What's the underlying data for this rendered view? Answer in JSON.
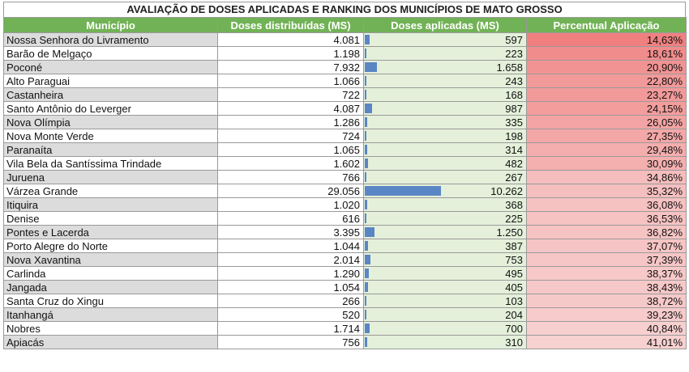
{
  "title": "AVALIAÇÃO DE DOSES APLICADAS E RANKING DOS MUNICÍPIOS DE MATO GROSSO",
  "headers": [
    "Município",
    "Doses distribuídas (MS)",
    "Doses aplicadas (MS)",
    "Percentual Aplicação"
  ],
  "colors": {
    "header_bg": "#72b256",
    "applied_bg": "#e4f0da",
    "databar": "#5b86c5",
    "pct_low": "#f08080",
    "pct_high": "#f7d0d0"
  },
  "rows": [
    {
      "municipio": "Nossa Senhora do Livramento",
      "distribuidas": "4.081",
      "aplicadas": "597",
      "percentual": "14,63%",
      "pct": 14.63,
      "aplicadas_num": 597
    },
    {
      "municipio": "Barão de Melgaço",
      "distribuidas": "1.198",
      "aplicadas": "223",
      "percentual": "18,61%",
      "pct": 18.61,
      "aplicadas_num": 223
    },
    {
      "municipio": "Poconé",
      "distribuidas": "7.932",
      "aplicadas": "1.658",
      "percentual": "20,90%",
      "pct": 20.9,
      "aplicadas_num": 1658
    },
    {
      "municipio": "Alto Paraguai",
      "distribuidas": "1.066",
      "aplicadas": "243",
      "percentual": "22,80%",
      "pct": 22.8,
      "aplicadas_num": 243
    },
    {
      "municipio": "Castanheira",
      "distribuidas": "722",
      "aplicadas": "168",
      "percentual": "23,27%",
      "pct": 23.27,
      "aplicadas_num": 168
    },
    {
      "municipio": "Santo Antônio do Leverger",
      "distribuidas": "4.087",
      "aplicadas": "987",
      "percentual": "24,15%",
      "pct": 24.15,
      "aplicadas_num": 987
    },
    {
      "municipio": "Nova Olímpia",
      "distribuidas": "1.286",
      "aplicadas": "335",
      "percentual": "26,05%",
      "pct": 26.05,
      "aplicadas_num": 335
    },
    {
      "municipio": "Nova Monte Verde",
      "distribuidas": "724",
      "aplicadas": "198",
      "percentual": "27,35%",
      "pct": 27.35,
      "aplicadas_num": 198
    },
    {
      "municipio": "Paranaíta",
      "distribuidas": "1.065",
      "aplicadas": "314",
      "percentual": "29,48%",
      "pct": 29.48,
      "aplicadas_num": 314
    },
    {
      "municipio": "Vila Bela da Santíssima Trindade",
      "distribuidas": "1.602",
      "aplicadas": "482",
      "percentual": "30,09%",
      "pct": 30.09,
      "aplicadas_num": 482
    },
    {
      "municipio": "Juruena",
      "distribuidas": "766",
      "aplicadas": "267",
      "percentual": "34,86%",
      "pct": 34.86,
      "aplicadas_num": 267
    },
    {
      "municipio": "Várzea Grande",
      "distribuidas": "29.056",
      "aplicadas": "10.262",
      "percentual": "35,32%",
      "pct": 35.32,
      "aplicadas_num": 10262
    },
    {
      "municipio": "Itiquira",
      "distribuidas": "1.020",
      "aplicadas": "368",
      "percentual": "36,08%",
      "pct": 36.08,
      "aplicadas_num": 368
    },
    {
      "municipio": "Denise",
      "distribuidas": "616",
      "aplicadas": "225",
      "percentual": "36,53%",
      "pct": 36.53,
      "aplicadas_num": 225
    },
    {
      "municipio": "Pontes e Lacerda",
      "distribuidas": "3.395",
      "aplicadas": "1.250",
      "percentual": "36,82%",
      "pct": 36.82,
      "aplicadas_num": 1250
    },
    {
      "municipio": "Porto Alegre do Norte",
      "distribuidas": "1.044",
      "aplicadas": "387",
      "percentual": "37,07%",
      "pct": 37.07,
      "aplicadas_num": 387
    },
    {
      "municipio": "Nova Xavantina",
      "distribuidas": "2.014",
      "aplicadas": "753",
      "percentual": "37,39%",
      "pct": 37.39,
      "aplicadas_num": 753
    },
    {
      "municipio": "Carlinda",
      "distribuidas": "1.290",
      "aplicadas": "495",
      "percentual": "38,37%",
      "pct": 38.37,
      "aplicadas_num": 495
    },
    {
      "municipio": "Jangada",
      "distribuidas": "1.054",
      "aplicadas": "405",
      "percentual": "38,43%",
      "pct": 38.43,
      "aplicadas_num": 405
    },
    {
      "municipio": "Santa Cruz do Xingu",
      "distribuidas": "266",
      "aplicadas": "103",
      "percentual": "38,72%",
      "pct": 38.72,
      "aplicadas_num": 103
    },
    {
      "municipio": "Itanhangá",
      "distribuidas": "520",
      "aplicadas": "204",
      "percentual": "39,23%",
      "pct": 39.23,
      "aplicadas_num": 204
    },
    {
      "municipio": "Nobres",
      "distribuidas": "1.714",
      "aplicadas": "700",
      "percentual": "40,84%",
      "pct": 40.84,
      "aplicadas_num": 700
    },
    {
      "municipio": "Apiacás",
      "distribuidas": "756",
      "aplicadas": "310",
      "percentual": "41,01%",
      "pct": 41.01,
      "aplicadas_num": 310
    }
  ]
}
